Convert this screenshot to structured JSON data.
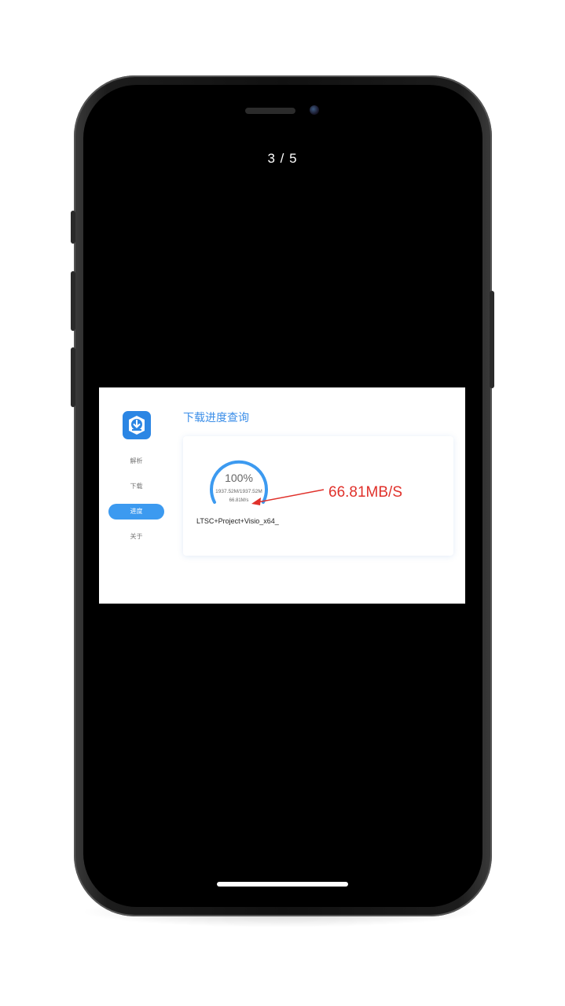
{
  "gallery": {
    "counter": "3 / 5"
  },
  "app": {
    "title": "下载进度查询",
    "nav": [
      {
        "label": "解析",
        "active": false
      },
      {
        "label": "下载",
        "active": false
      },
      {
        "label": "进度",
        "active": true
      },
      {
        "label": "关于",
        "active": false
      }
    ],
    "progress": {
      "percent_text": "100%",
      "percent_value": 1.0,
      "size_text": "1937.52M/1937.52M",
      "speed_text": "66.81M/s"
    },
    "file_name": "LTSC+Project+Visio_x64_"
  },
  "annotation": {
    "speed_label": "66.81MB/S",
    "color": "#e0312b"
  },
  "colors": {
    "accent": "#3c9af0",
    "title_blue": "#3b8ee8"
  },
  "icons": {
    "logo": "download-icon"
  }
}
